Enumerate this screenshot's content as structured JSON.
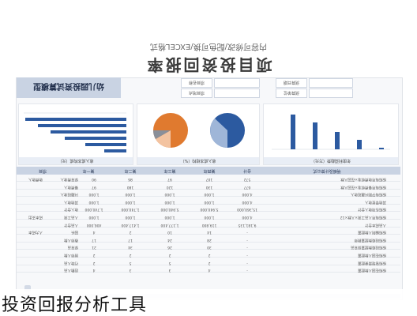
{
  "page_title": "项目投资回报率",
  "page_subtitle": "内容可修改/配色可换/EXCEL格式",
  "sheet": {
    "kpi_title": "幼儿园投资试算模型",
    "info_labels": [
      "项目名称",
      "项目地点",
      "测算日期",
      "测算单位"
    ],
    "panels": [
      {
        "title": "收入成本构成（元）"
      },
      {
        "title": "收入成本结构（%）"
      },
      {
        "title": "年度利润趋势（万元）"
      }
    ],
    "bar_chart_labels": [
      "第一年",
      "第二年",
      "第三年",
      "第四年",
      "第五年"
    ],
    "bar_chart_values": [
      "-",
      "32.4",
      "89.6",
      "135.2",
      "179.8"
    ],
    "table_headers": [
      "项目",
      "第一年",
      "第二年",
      "第三年",
      "第四年",
      "合计",
      "明细及计算公式"
    ],
    "rows": [
      {
        "group": "收费收入",
        "item": "保育费收入",
        "y1": "90",
        "y2": "86",
        "y3": "97",
        "y4": "107",
        "total": "572",
        "note": "按照每月收费标准×在园人数"
      },
      {
        "group": "",
        "item": "餐费收入",
        "y1": "97",
        "y2": "180",
        "y3": "120",
        "y4": "130",
        "total": "677",
        "note": "按照每月餐费标准×在园人数"
      },
      {
        "group": "",
        "item": "兴趣班收入",
        "y1": "1,000",
        "y2": "1,000",
        "y3": "1,000",
        "y4": "1,000",
        "total": "4,000",
        "note": "按照每学期兴趣班收入"
      },
      {
        "group": "",
        "item": "其他收入",
        "y1": "1,000",
        "y2": "1,000",
        "y3": "1,000",
        "y4": "1,000",
        "total": "4,000",
        "note": "其他零星收入"
      },
      {
        "group": "",
        "item": "收入合计",
        "y1": "1,740,000",
        "y2": "1,740,000",
        "y3": "5,940,000",
        "y4": "5,940,000",
        "total": "15,360,000",
        "note": "按照各项收入合计"
      },
      {
        "group": "成本支出",
        "item": "人员工资",
        "y1": "1,000",
        "y2": "1,000",
        "y3": "1,000",
        "y4": "1,000",
        "total": "4,000",
        "note": "按照每月人员工资×人数×12"
      },
      {
        "group": "",
        "item": "人员合计",
        "y1": "406,000",
        "y2": "1,417,400",
        "y3": "1,177,400",
        "y4": "119,800",
        "total": "9,181,135",
        "note": "人员成本合计"
      },
      {
        "group": "人力成本",
        "item": "园长",
        "y1": "4",
        "y2": "2",
        "y3": "10",
        "y4": "14",
        "total": "-",
        "note": "按照编制人数配置"
      },
      {
        "group": "",
        "item": "教师人数",
        "y1": "17",
        "y2": "17",
        "y3": "24",
        "y4": "28",
        "total": "-",
        "note": "按照班级数配置教师"
      },
      {
        "group": "",
        "item": "保育员",
        "y1": "21",
        "y2": "34",
        "y3": "26",
        "y4": "30",
        "total": "-",
        "note": "按照班级数配置保育员"
      },
      {
        "group": "",
        "item": "厨师人数",
        "y1": "2",
        "y2": "2",
        "y3": "2",
        "y4": "2",
        "total": "-",
        "note": "按照在园人数配置"
      },
      {
        "group": "",
        "item": "行政人员",
        "y1": "2",
        "y2": "5",
        "y3": "5",
        "y4": "2",
        "total": "-",
        "note": "按照管理需要配置"
      },
      {
        "group": "",
        "item": "后勤人员",
        "y1": "4",
        "y2": "3",
        "y3": "3",
        "y4": "4",
        "total": "-",
        "note": "按照在园人数配置"
      }
    ]
  },
  "caption": "投资回报分析工具"
}
